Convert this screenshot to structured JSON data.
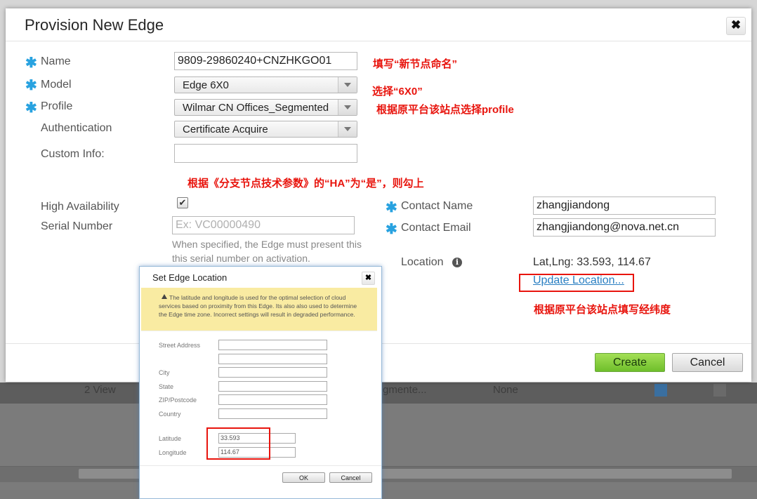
{
  "background": {
    "row_text": [
      "2 View",
      "gmente...",
      "None"
    ],
    "accent": "#28a2e0"
  },
  "dialog": {
    "title": "Provision New Edge",
    "close_label": "✖",
    "fields": {
      "name": {
        "label": "Name",
        "value": "9809-29860240+CNZHKGO01"
      },
      "model": {
        "label": "Model",
        "value": "Edge 6X0"
      },
      "profile": {
        "label": "Profile",
        "value": "Wilmar CN Offices_Segmented"
      },
      "authentication": {
        "label": "Authentication",
        "value": "Certificate Acquire"
      },
      "custom_info": {
        "label": "Custom Info:",
        "value": ""
      },
      "high_availability": {
        "label": "High Availability",
        "checked": true,
        "check_glyph": "✔"
      },
      "serial_number": {
        "label": "Serial Number",
        "placeholder": "Ex: VC00000490",
        "note_line1": "When specified, the Edge must present this",
        "note_line2": "this serial number on activation."
      },
      "contact_name": {
        "label": "Contact Name",
        "value": "zhangjiandong"
      },
      "contact_email": {
        "label": "Contact Email",
        "value": "zhangjiandong@nova.net.cn"
      },
      "location": {
        "label": "Location",
        "value": "Lat,Lng: 33.593, 114.67",
        "update_link": "Update Location..."
      }
    },
    "buttons": {
      "create": "Create",
      "cancel": "Cancel"
    }
  },
  "annotations": {
    "name_hint": "填写“新节点命名”",
    "model_hint": "选择“6X0”",
    "profile_hint": "根据原平台该站点选择profile",
    "ha_hint": "根据《分支节点技术参数》的“HA”为“是”，则勾上",
    "location_hint": "根据原平台该站点填写经纬度",
    "color": "#e8140d"
  },
  "location_modal": {
    "title": "Set Edge Location",
    "close_label": "✖",
    "warning": "The latitude and longitude is used for the optimal selection of cloud services based on proximity from this Edge. Its also also used to determine the Edge time zone. Incorrect settings will result in degraded performance.",
    "labels": {
      "street": "Street Address",
      "city": "City",
      "state": "State",
      "zip": "ZIP/Postcode",
      "country": "Country",
      "latitude": "Latitude",
      "longitude": "Longitude"
    },
    "latitude": "33.593",
    "longitude": "114.67",
    "buttons": {
      "ok": "OK",
      "cancel": "Cancel"
    }
  }
}
